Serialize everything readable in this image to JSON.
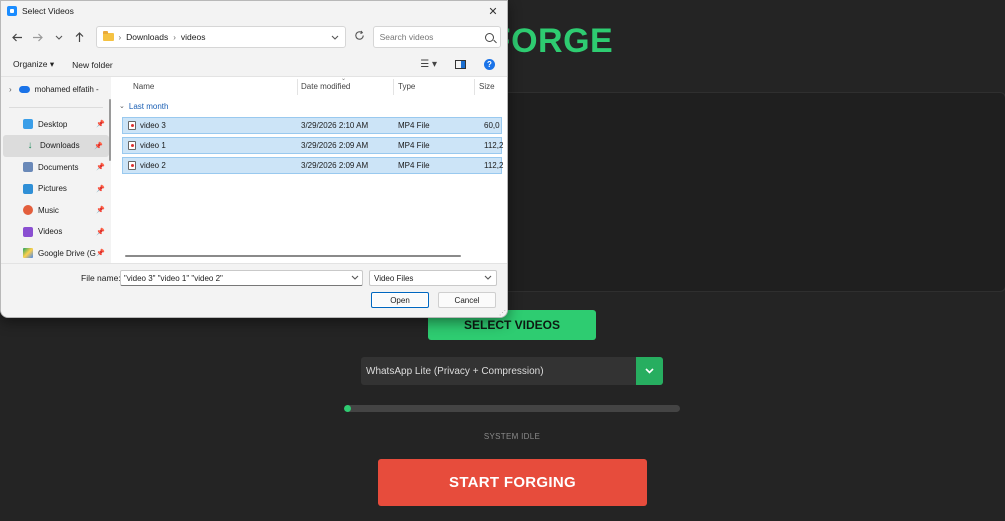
{
  "app": {
    "title_visible": "FORGE",
    "select_button": "SELECT VIDEOS",
    "preset": "WhatsApp Lite (Privacy + Compression)",
    "progress_fraction": 0.0,
    "status": "SYSTEM IDLE",
    "start_button": "START FORGING",
    "colors": {
      "accent": "#2ecc71",
      "danger": "#e74c3c",
      "background": "#242424"
    }
  },
  "dialog": {
    "title": "Select Videos",
    "close_glyph": "✕",
    "breadcrumb": [
      "Downloads",
      "videos"
    ],
    "search_placeholder": "Search videos",
    "commands": {
      "organize": "Organize ▾",
      "new_folder": "New folder"
    },
    "nav": {
      "top": "mohamed elfatih -",
      "items": [
        {
          "label": "Desktop",
          "icon": "desktop-icon"
        },
        {
          "label": "Downloads",
          "icon": "downloads-icon"
        },
        {
          "label": "Documents",
          "icon": "documents-icon"
        },
        {
          "label": "Pictures",
          "icon": "pictures-icon"
        },
        {
          "label": "Music",
          "icon": "music-icon"
        },
        {
          "label": "Videos",
          "icon": "videos-icon"
        },
        {
          "label": "Google Drive (G",
          "icon": "google-drive-icon"
        }
      ]
    },
    "columns": {
      "name": "Name",
      "date": "Date modified",
      "type": "Type",
      "size": "Size"
    },
    "group": "Last month",
    "files": [
      {
        "name": "video 3",
        "date": "3/29/2026 2:10 AM",
        "type": "MP4 File",
        "size": "60,0"
      },
      {
        "name": "video 1",
        "date": "3/29/2026 2:09 AM",
        "type": "MP4 File",
        "size": "112,2"
      },
      {
        "name": "video 2",
        "date": "3/29/2026 2:09 AM",
        "type": "MP4 File",
        "size": "112,2"
      }
    ],
    "footer": {
      "file_name_label": "File name:",
      "file_name_value": "\"video 3\" \"video 1\" \"video 2\"",
      "filter": "Video Files",
      "open": "Open",
      "cancel": "Cancel"
    }
  }
}
